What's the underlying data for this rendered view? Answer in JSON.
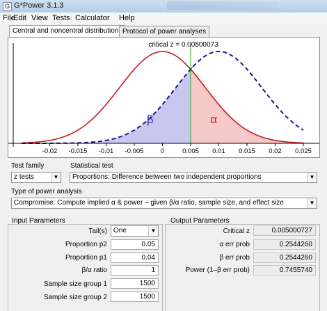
{
  "window": {
    "title": "G*Power 3.1.3",
    "icon": "gpower-app-icon"
  },
  "menu": [
    "File",
    "Edit",
    "View",
    "Tests",
    "Calculator",
    "Help"
  ],
  "tabs": [
    {
      "label": "Central and noncentral distributions",
      "active": true
    },
    {
      "label": "Protocol of power analyses",
      "active": false
    }
  ],
  "chart_data": {
    "type": "line",
    "title": "critical z = 0.00500073",
    "xlim": [
      -0.025,
      0.025
    ],
    "x_ticks": [
      "-0.02",
      "-0.015",
      "-0.01",
      "-0.005",
      "0",
      "0.005",
      "0.01",
      "0.015",
      "0.02",
      "0.025"
    ],
    "x_tick_values": [
      -0.02,
      -0.015,
      -0.01,
      -0.005,
      0,
      0.005,
      0.01,
      0.015,
      0.02,
      0.025
    ],
    "critical_value": 0.00500073,
    "series": [
      {
        "dist": "central",
        "mean": 0.0,
        "sd": 0.00762,
        "color": "#c41e1e",
        "style": "solid"
      },
      {
        "dist": "noncentral",
        "mean": 0.01,
        "sd": 0.00762,
        "color": "#1a1a8c",
        "style": "dashed"
      }
    ],
    "regions": [
      {
        "label": "β",
        "fill": "#c8c8ef",
        "color": "#3333aa"
      },
      {
        "label": "α",
        "fill": "#f6c9c9",
        "color": "#cc2222"
      }
    ],
    "critical_line_color": "#22aa22",
    "grid": false
  },
  "test_family": {
    "label": "Test family",
    "value": "z tests"
  },
  "statistical_test": {
    "label": "Statistical test",
    "value": "Proportions: Difference between two independent proportions"
  },
  "power_analysis": {
    "label": "Type of power analysis",
    "value": "Compromise: Compute implied α & power – given β/α ratio, sample size, and effect size"
  },
  "input": {
    "heading": "Input Parameters",
    "tails": {
      "label": "Tail(s)",
      "value": "One"
    },
    "rows": [
      {
        "label": "Proportion p2",
        "value": "0.05"
      },
      {
        "label": "Proportion p1",
        "value": "0.04"
      },
      {
        "label": "β/α ratio",
        "value": "1"
      },
      {
        "label": "Sample size group 1",
        "value": "1500"
      },
      {
        "label": "Sample size group 2",
        "value": "1500"
      }
    ]
  },
  "output": {
    "heading": "Output Parameters",
    "rows": [
      {
        "label": "Critical z",
        "value": "0.005000727"
      },
      {
        "label": "α err prob",
        "value": "0.2544260"
      },
      {
        "label": "β err prob",
        "value": "0.2544260"
      },
      {
        "label": "Power (1–β err prob)",
        "value": "0.7455740"
      }
    ]
  }
}
